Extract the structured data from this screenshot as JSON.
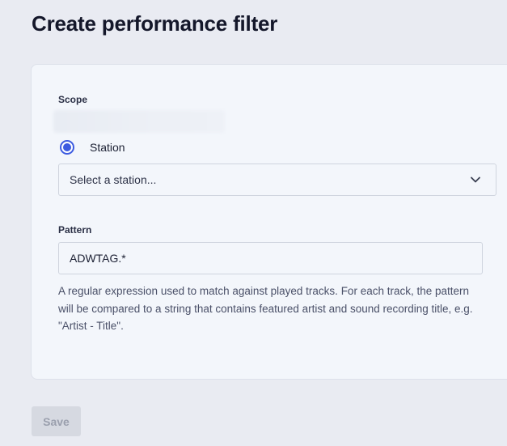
{
  "page": {
    "title": "Create performance filter"
  },
  "scope": {
    "label": "Scope",
    "radio_label": "Station",
    "radio_checked": true,
    "select_value": "Select a station...",
    "select_icon": "chevron-down-icon"
  },
  "pattern": {
    "label": "Pattern",
    "value": "ADWTAG.*",
    "help": "A regular expression used to match against played tracks. For each track, the pattern will be compared to a string that contains featured artist and sound recording title, e.g. \"Artist - Title\"."
  },
  "actions": {
    "save_label": "Save",
    "save_disabled": true
  },
  "colors": {
    "accent": "#3c5be0",
    "background": "#e9ebf2",
    "card": "#f3f6fb"
  }
}
